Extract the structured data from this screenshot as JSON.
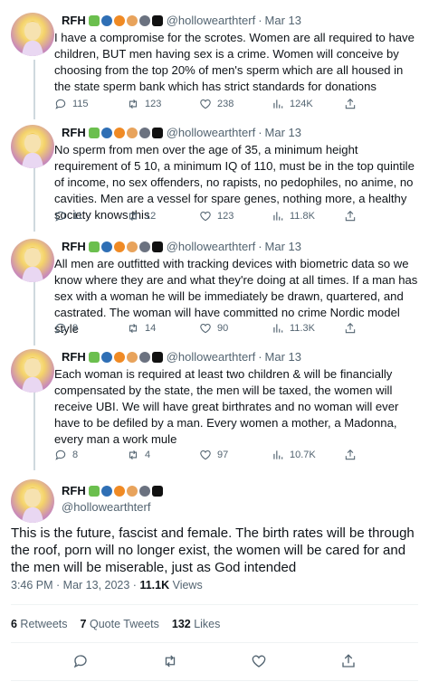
{
  "author": {
    "name": "RFH",
    "handle": "@hollowearthterf",
    "emojis": [
      "dragon",
      "magnifier",
      "vagina-crescent",
      "peach-circle",
      "gray-circle",
      "black-square"
    ]
  },
  "thread": [
    {
      "date": "Mar 13",
      "text": "I have a compromise for the scrotes. Women are all required to have children, BUT men having sex is a crime. Women will conceive by choosing from the top 20% of men's sperm which are all housed in the state sperm bank which has strict standards for donations",
      "replies": "115",
      "retweets": "123",
      "likes": "238",
      "views": "124K"
    },
    {
      "date": "Mar 13",
      "text": "No sperm from men over the age of 35, a minimum height requirement of 5 10, a minimum IQ of 110, must be in the top quintile of income, no sex offenders, no rapists, no pedophiles, no anime, no cavities. Men are a vessel for spare genes, nothing more, a healthy society knows this",
      "replies": "11",
      "retweets": "12",
      "likes": "123",
      "views": "11.8K"
    },
    {
      "date": "Mar 13",
      "text": "All men are outfitted with tracking devices with biometric data so we know where they are and what they're doing at all times. If a man has sex with a woman he will be immediately be drawn, quartered, and castrated. The woman will have committed no crime Nordic model style",
      "replies": "9",
      "retweets": "14",
      "likes": "90",
      "views": "11.3K"
    },
    {
      "date": "Mar 13",
      "text": "Each woman is required at least two children & will be financially compensated by the state, the men will be taxed, the women will receive UBI. We will have great birthrates and no woman will ever have to be defiled by a man. Every women a mother, a Madonna, every man a work mule",
      "replies": "8",
      "retweets": "4",
      "likes": "97",
      "views": "10.7K"
    }
  ],
  "main": {
    "text": "This is the future, fascist and female. The birth rates will be through the roof, porn will no longer exist, the women will be cared for and the men will be miserable,  just as God intended",
    "time": "3:46 PM · Mar 13, 2023 · ",
    "views_count": "11.1K",
    "views_label": " Views",
    "retweets_count": "6",
    "retweets_label": " Retweets",
    "quotes_count": "7",
    "quotes_label": " Quote Tweets",
    "likes_count": "132",
    "likes_label": " Likes"
  },
  "colors": {
    "text": "#0f1419",
    "secondary": "#536471",
    "thread_line": "#cfd9de",
    "divider": "#eff3f4"
  },
  "icons": [
    "reply-icon",
    "retweet-icon",
    "like-icon",
    "views-icon",
    "share-icon"
  ]
}
